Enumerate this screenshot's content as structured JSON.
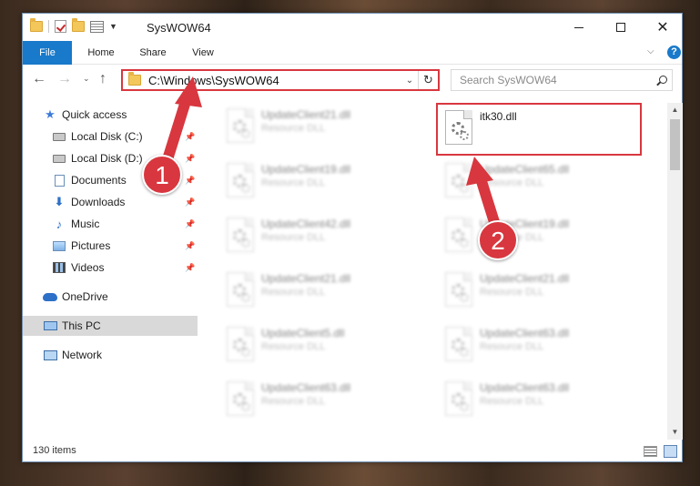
{
  "window": {
    "title": "SysWOW64"
  },
  "ribbon": {
    "tabs": [
      "File",
      "Home",
      "Share",
      "View"
    ],
    "help": "?"
  },
  "nav": {
    "address": "C:\\Windows\\SysWOW64",
    "search_placeholder": "Search SysWOW64"
  },
  "sidebar": {
    "items": [
      {
        "label": "Quick access",
        "icon": "star-icon"
      },
      {
        "label": "Local Disk (C:)",
        "icon": "drive-icon",
        "pinned": true
      },
      {
        "label": "Local Disk (D:)",
        "icon": "drive-icon",
        "pinned": true
      },
      {
        "label": "Documents",
        "icon": "documents-icon",
        "pinned": true
      },
      {
        "label": "Downloads",
        "icon": "downloads-icon",
        "pinned": true
      },
      {
        "label": "Music",
        "icon": "music-icon",
        "pinned": true
      },
      {
        "label": "Pictures",
        "icon": "pictures-icon",
        "pinned": true
      },
      {
        "label": "Videos",
        "icon": "videos-icon",
        "pinned": true
      },
      {
        "label": "OneDrive",
        "icon": "onedrive-icon"
      },
      {
        "label": "This PC",
        "icon": "this-pc-icon",
        "selected": true
      },
      {
        "label": "Network",
        "icon": "network-icon"
      }
    ]
  },
  "files": {
    "highlighted": {
      "name": "itk30.dll",
      "type": ""
    },
    "items": [
      {
        "name": "UpdateClient21.dll",
        "type": "Resource DLL"
      },
      {
        "name": "UpdateClient19.dll",
        "type": "Resource DLL"
      },
      {
        "name": "UpdateClient65.dll",
        "type": "Resource DLL"
      },
      {
        "name": "UpdateClient42.dll",
        "type": "Resource DLL"
      },
      {
        "name": "UpdateClient19.dll",
        "type": "Resource DLL"
      },
      {
        "name": "UpdateClient21.dll",
        "type": "Resource DLL"
      },
      {
        "name": "UpdateClient21.dll",
        "type": "Resource DLL"
      },
      {
        "name": "UpdateClient5.dll",
        "type": "Resource DLL"
      },
      {
        "name": "UpdateClient63.dll",
        "type": "Resource DLL"
      },
      {
        "name": "UpdateClient63.dll",
        "type": "Resource DLL"
      },
      {
        "name": "UpdateClient63.dll",
        "type": "Resource DLL"
      }
    ]
  },
  "status": {
    "item_count": "130 items"
  },
  "annotations": {
    "step1": "1",
    "step2": "2",
    "color": "#d8373f"
  }
}
